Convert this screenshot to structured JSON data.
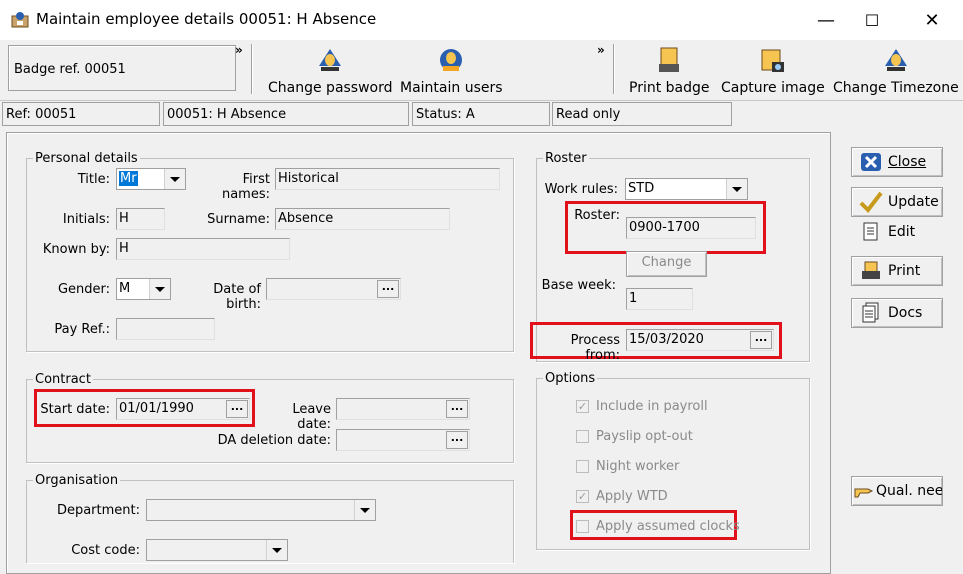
{
  "window": {
    "title": "Maintain employee details 00051: H Absence",
    "minimize": "—",
    "maximize": "☐",
    "close": "✕"
  },
  "toolbar": {
    "badge_ref": "Badge ref. 00051",
    "chevron": "»",
    "change_password": "Change password",
    "maintain_users": "Maintain users",
    "print_badge": "Print badge",
    "capture_image": "Capture image",
    "change_timezone": "Change Timezone"
  },
  "status": {
    "ref": "Ref: 00051",
    "name": "00051: H Absence",
    "status": "Status: A",
    "mode": "Read only"
  },
  "personal": {
    "legend": "Personal details",
    "title_label": "Title:",
    "title_value": "Mr",
    "first_names_label": "First names:",
    "first_names_value": "Historical",
    "initials_label": "Initials:",
    "initials_value": "H",
    "surname_label": "Surname:",
    "surname_value": "Absence",
    "known_by_label": "Known by:",
    "known_by_value": "H",
    "gender_label": "Gender:",
    "gender_value": "M",
    "dob_label": "Date of birth:",
    "dob_value": "",
    "pay_ref_label": "Pay Ref.:",
    "pay_ref_value": ""
  },
  "contract": {
    "legend": "Contract",
    "start_label": "Start date:",
    "start_value": "01/01/1990",
    "leave_label": "Leave date:",
    "leave_value": "",
    "da_label": "DA deletion date:",
    "da_value": ""
  },
  "organisation": {
    "legend": "Organisation",
    "department_label": "Department:",
    "department_value": "",
    "cost_code_label": "Cost code:",
    "cost_code_value": ""
  },
  "roster": {
    "legend": "Roster",
    "work_rules_label": "Work rules:",
    "work_rules_value": "STD",
    "roster_label": "Roster:",
    "roster_value": "0900-1700",
    "change_button": "Change",
    "base_week_label": "Base week:",
    "base_week_value": "1",
    "process_from_label": "Process from:",
    "process_from_value": "15/03/2020"
  },
  "options": {
    "legend": "Options",
    "items": [
      {
        "label": "Include in payroll",
        "checked": true
      },
      {
        "label": "Payslip opt-out",
        "checked": false
      },
      {
        "label": "Night worker",
        "checked": false
      },
      {
        "label": "Apply WTD",
        "checked": true
      },
      {
        "label": "Apply assumed clocks",
        "checked": false
      }
    ]
  },
  "actions": {
    "close": "Close",
    "update": "Update",
    "edit": "Edit",
    "print": "Print",
    "docs": "Docs",
    "qual_needs": "Qual. needs"
  },
  "ellipsis": "..."
}
